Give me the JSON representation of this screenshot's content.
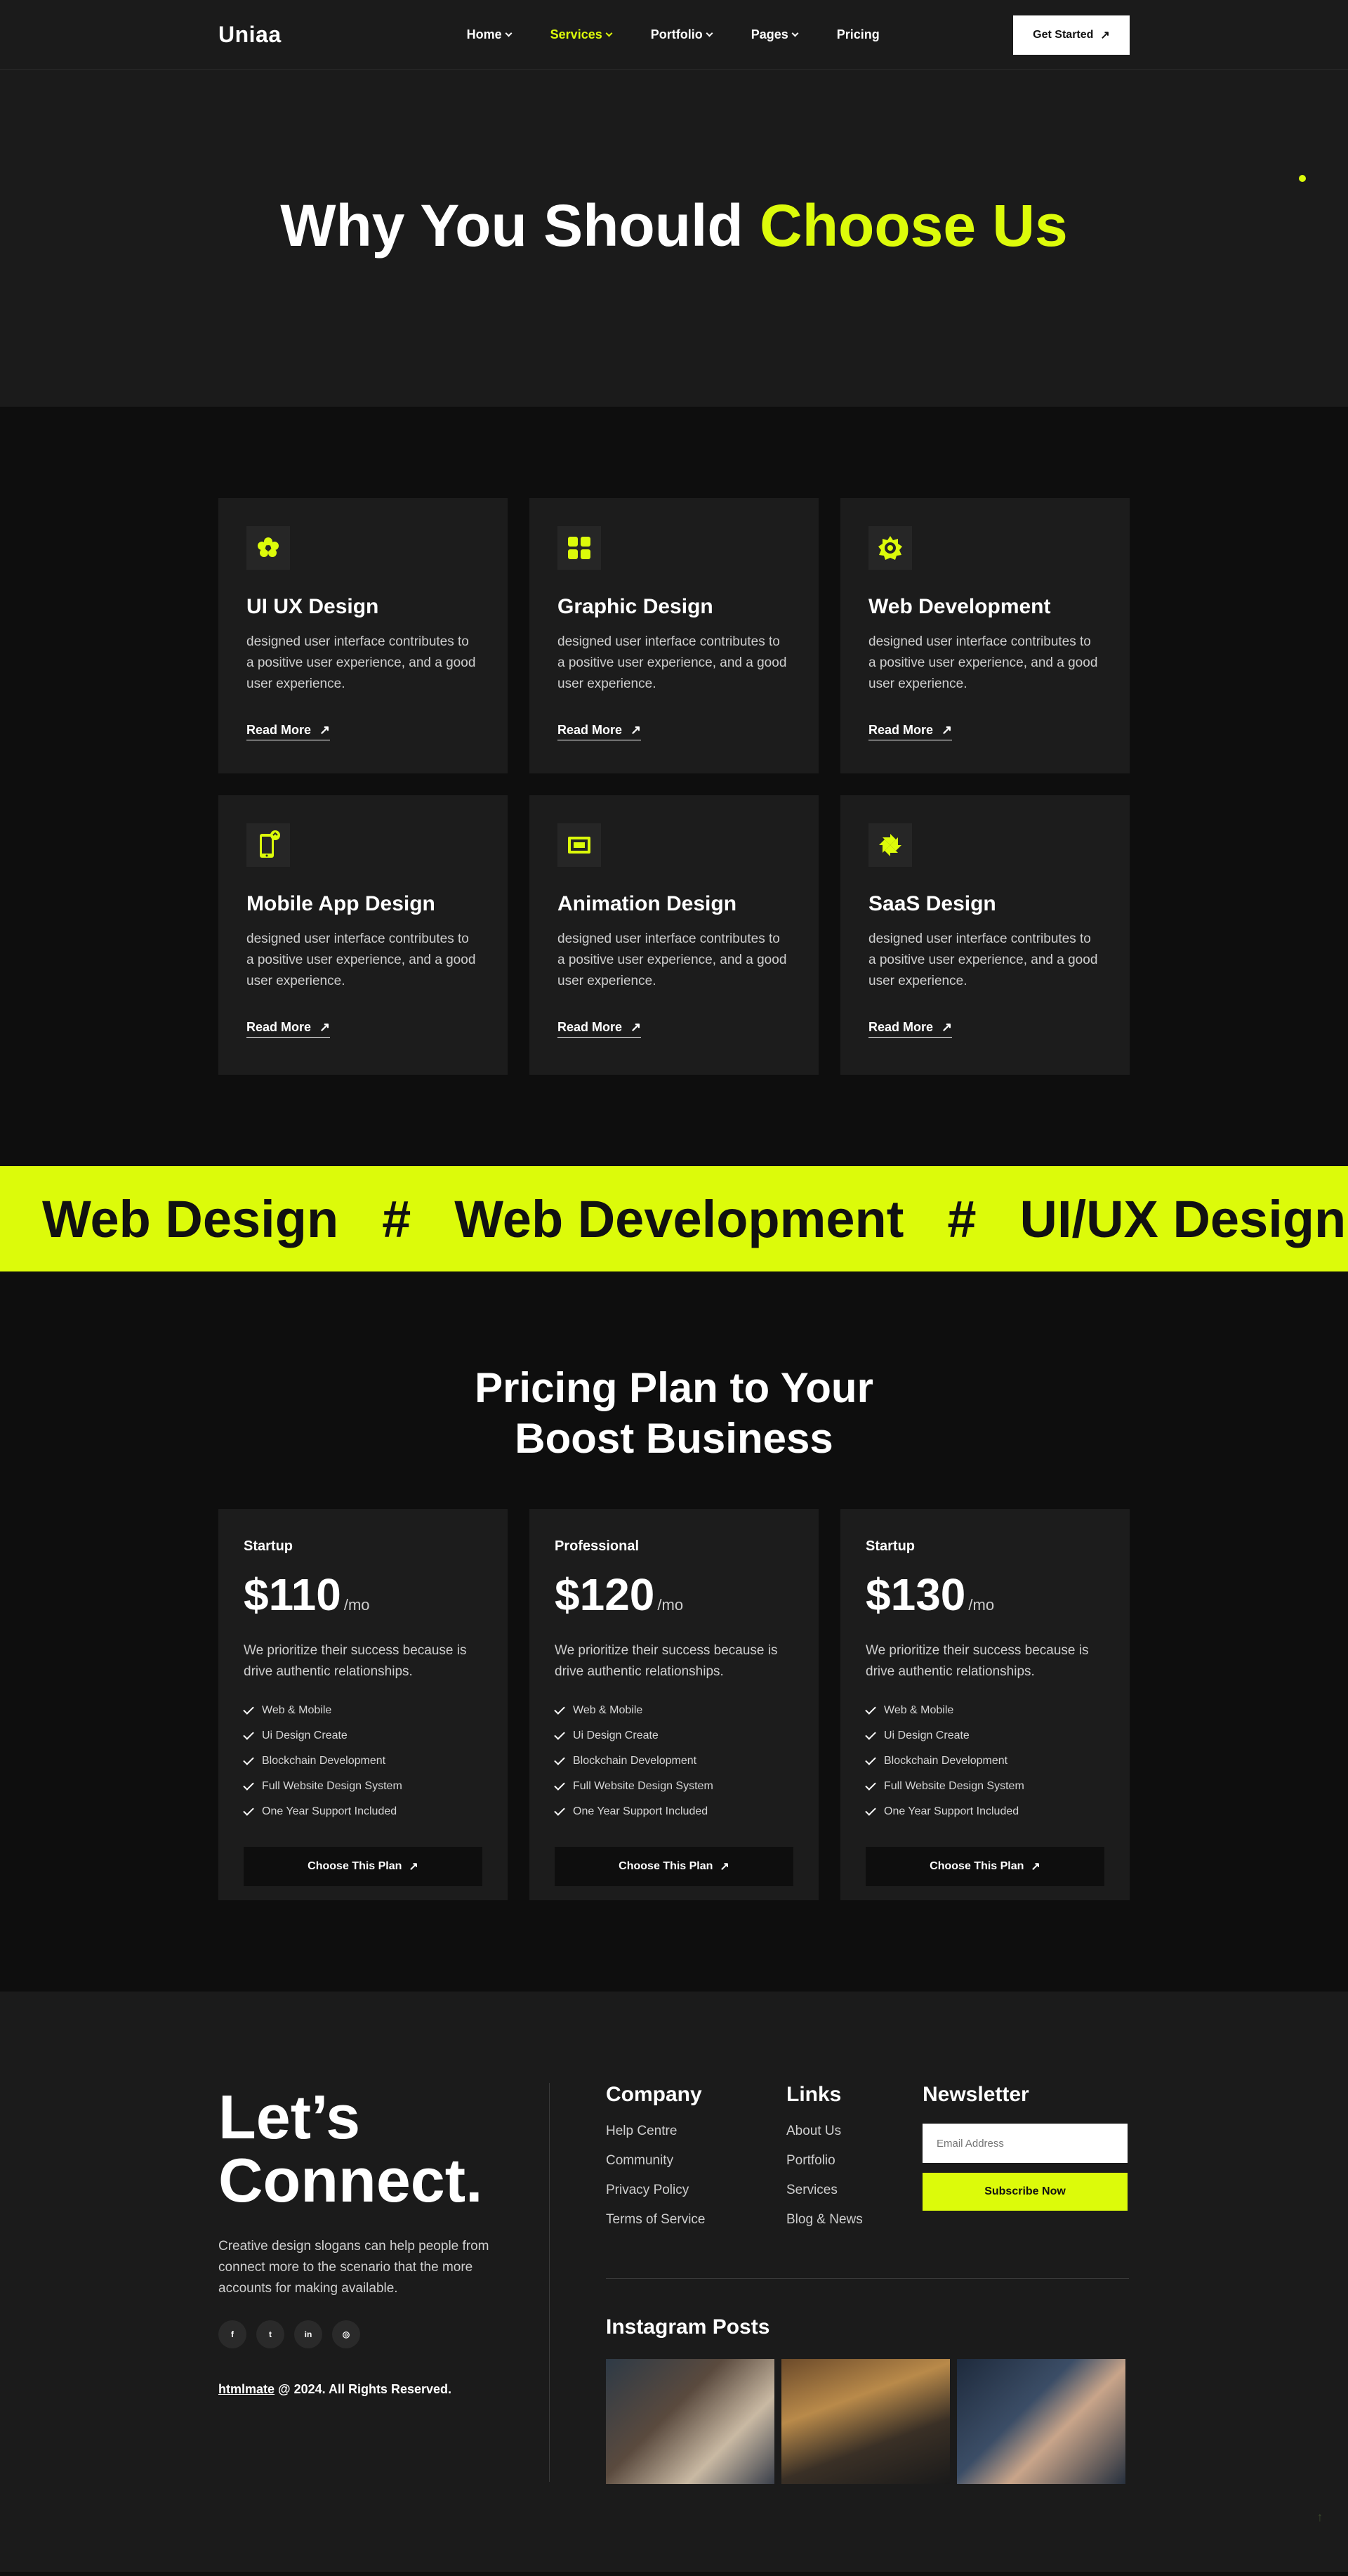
{
  "header": {
    "logo": "Uniaa",
    "nav": [
      {
        "label": "Home",
        "dropdown": true,
        "active": false
      },
      {
        "label": "Services",
        "dropdown": true,
        "active": true
      },
      {
        "label": "Portfolio",
        "dropdown": true,
        "active": false
      },
      {
        "label": "Pages",
        "dropdown": true,
        "active": false
      },
      {
        "label": "Pricing",
        "dropdown": false,
        "active": false
      }
    ],
    "cta_label": "Get Started"
  },
  "hero": {
    "title_main": "Why You Should ",
    "title_accent": "Choose Us"
  },
  "services": [
    {
      "title": "UI UX Design",
      "text": "designed user interface contributes to a positive user experience, and a good user experience.",
      "link": "Read More",
      "icon": "flower-cluster-icon"
    },
    {
      "title": "Graphic Design",
      "text": "designed user interface contributes to a positive user experience, and a good user experience.",
      "link": "Read More",
      "icon": "four-squares-icon"
    },
    {
      "title": "Web Development",
      "text": "designed user interface contributes to a positive user experience, and a good user experience.",
      "link": "Read More",
      "icon": "gear-eye-icon"
    },
    {
      "title": "Mobile App Design",
      "text": "designed user interface contributes to a positive user experience, and a good user experience.",
      "link": "Read More",
      "icon": "mobile-phone-icon"
    },
    {
      "title": "Animation Design",
      "text": "designed user interface contributes to a positive user experience, and a good user experience.",
      "link": "Read More",
      "icon": "animation-screen-icon"
    },
    {
      "title": "SaaS Design",
      "text": "designed user interface contributes to a positive user experience, and a good user experience.",
      "link": "Read More",
      "icon": "pinwheel-icon"
    }
  ],
  "marquee": {
    "items": [
      "Web Design",
      "#",
      "Web Development",
      "#",
      "UI/UX Design"
    ]
  },
  "pricing": {
    "title_line1": "Pricing Plan to Your",
    "title_line2": "Boost Business",
    "plans": [
      {
        "name": "Startup",
        "price": "$110",
        "period": "/mo",
        "desc": "We prioritize their success because is drive authentic relationships.",
        "features": [
          "Web & Mobile",
          "Ui Design Create",
          "Blockchain Development",
          "Full Website Design System",
          "One Year Support Included"
        ],
        "cta": "Choose This Plan"
      },
      {
        "name": "Professional",
        "price": "$120",
        "period": "/mo",
        "desc": "We prioritize their success because is drive authentic relationships.",
        "features": [
          "Web & Mobile",
          "Ui Design Create",
          "Blockchain Development",
          "Full Website Design System",
          "One Year Support Included"
        ],
        "cta": "Choose This Plan"
      },
      {
        "name": "Startup",
        "price": "$130",
        "period": "/mo",
        "desc": "We prioritize their success because is drive authentic relationships.",
        "features": [
          "Web & Mobile",
          "Ui Design Create",
          "Blockchain Development",
          "Full Website Design System",
          "One Year Support Included"
        ],
        "cta": "Choose This Plan"
      }
    ]
  },
  "footer": {
    "heading_line1": "Let’s",
    "heading_line2": "Connect.",
    "text": "Creative design slogans can help people from connect more to the scenario that the more accounts for making available.",
    "social": [
      {
        "icon": "facebook-icon",
        "glyph": "f"
      },
      {
        "icon": "twitter-icon",
        "glyph": "t"
      },
      {
        "icon": "linkedin-icon",
        "glyph": "in"
      },
      {
        "icon": "instagram-icon",
        "glyph": "◎"
      }
    ],
    "copyright_brand": "htmlmate",
    "copyright_rest": " @ 2024. All Rights Reserved.",
    "company": {
      "title": "Company",
      "items": [
        "Help Centre",
        "Community",
        "Privacy Policy",
        "Terms of Service"
      ]
    },
    "links": {
      "title": "Links",
      "items": [
        "About Us",
        "Portfolio",
        "Services",
        "Blog & News"
      ]
    },
    "newsletter": {
      "title": "Newsletter",
      "placeholder": "Email Address",
      "button": "Subscribe Now"
    },
    "instagram_title": "Instagram Posts"
  },
  "colors": {
    "accent": "#dcfb0a",
    "background": "#0e0e0e",
    "surface": "#1c1c1c"
  }
}
